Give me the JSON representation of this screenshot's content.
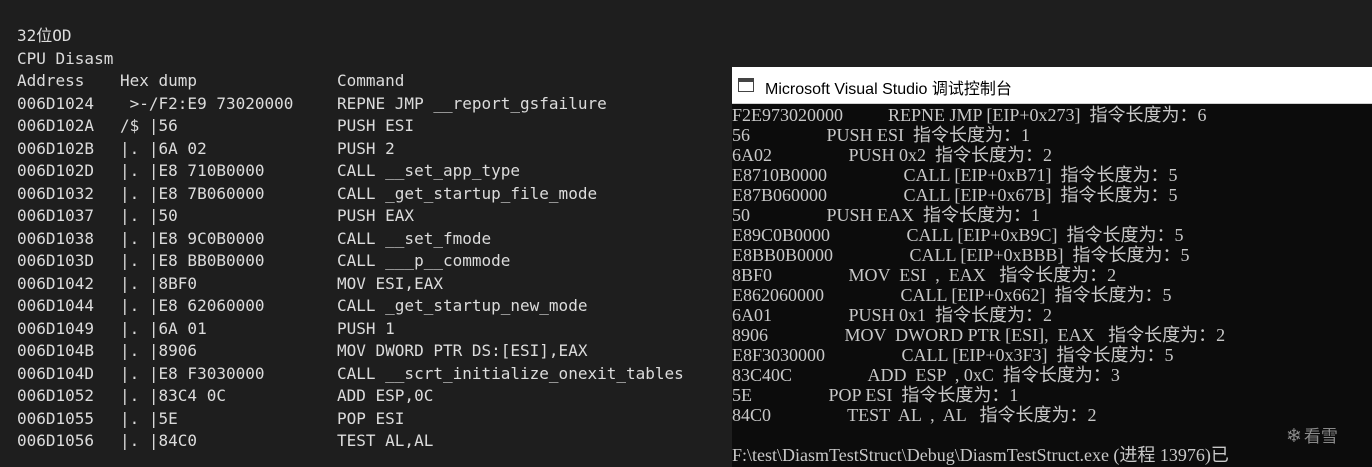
{
  "left_panel": {
    "title": "32位OD",
    "subtitle": "CPU Disasm",
    "columns": {
      "address": "Address",
      "hex": "Hex dump",
      "command": "Command"
    },
    "rows": [
      {
        "address": "006D1024",
        "hex": " >-/F2:E9 73020000",
        "command": "REPNE JMP __report_gsfailure"
      },
      {
        "address": "006D102A",
        "hex": "/$ |56",
        "command": "PUSH ESI"
      },
      {
        "address": "006D102B",
        "hex": "|. |6A 02",
        "command": "PUSH 2"
      },
      {
        "address": "006D102D",
        "hex": "|. |E8 710B0000",
        "command": "CALL __set_app_type"
      },
      {
        "address": "006D1032",
        "hex": "|. |E8 7B060000",
        "command": "CALL _get_startup_file_mode"
      },
      {
        "address": "006D1037",
        "hex": "|. |50",
        "command": "PUSH EAX"
      },
      {
        "address": "006D1038",
        "hex": "|. |E8 9C0B0000",
        "command": "CALL __set_fmode"
      },
      {
        "address": "006D103D",
        "hex": "|. |E8 BB0B0000",
        "command": "CALL ___p__commode"
      },
      {
        "address": "006D1042",
        "hex": "|. |8BF0",
        "command": "MOV ESI,EAX"
      },
      {
        "address": "006D1044",
        "hex": "|. |E8 62060000",
        "command": "CALL _get_startup_new_mode"
      },
      {
        "address": "006D1049",
        "hex": "|. |6A 01",
        "command": "PUSH 1"
      },
      {
        "address": "006D104B",
        "hex": "|. |8906",
        "command": "MOV DWORD PTR DS:[ESI],EAX"
      },
      {
        "address": "006D104D",
        "hex": "|. |E8 F3030000",
        "command": "CALL __scrt_initialize_onexit_tables"
      },
      {
        "address": "006D1052",
        "hex": "|. |83C4 0C",
        "command": "ADD ESP,0C"
      },
      {
        "address": "006D1055",
        "hex": "|. |5E",
        "command": "POP ESI"
      },
      {
        "address": "006D1056",
        "hex": "|. |84C0",
        "command": "TEST AL,AL"
      }
    ]
  },
  "console": {
    "title": "Microsoft Visual Studio 调试控制台",
    "lines": [
      "F2E973020000          REPNE JMP [EIP+0x273]  指令长度为：6",
      "56                 PUSH ESI  指令长度为：1",
      "6A02                 PUSH 0x2  指令长度为：2",
      "E8710B0000                 CALL [EIP+0xB71]  指令长度为：5",
      "E87B060000                 CALL [EIP+0x67B]  指令长度为：5",
      "50                 PUSH EAX  指令长度为：1",
      "E89C0B0000                 CALL [EIP+0xB9C]  指令长度为：5",
      "E8BB0B0000                 CALL [EIP+0xBBB]  指令长度为：5",
      "8BF0                 MOV  ESI  ,  EAX   指令长度为：2",
      "E862060000                 CALL [EIP+0x662]  指令长度为：5",
      "6A01                 PUSH 0x1  指令长度为：2",
      "8906                 MOV  DWORD PTR [ESI],  EAX   指令长度为：2",
      "E8F3030000                 CALL [EIP+0x3F3]  指令长度为：5",
      "83C40C                 ADD  ESP  , 0xC  指令长度为：3",
      "5E                 POP ESI  指令长度为：1",
      "84C0                 TEST  AL  ,  AL   指令长度为：2",
      "",
      "F:\\test\\DiasmTestStruct\\Debug\\DiasmTestStruct.exe (进程 13976)已"
    ],
    "watermark": "看雪"
  },
  "colors": {
    "left_background": "#1e1e1e",
    "left_text": "#dcdcdc",
    "console_background": "#0c0c0c",
    "console_text": "#c8c8c8",
    "titlebar_background": "#ffffff"
  },
  "icons": {
    "window_icon": "console-window-icon",
    "watermark_icon": "snowflake-icon"
  }
}
